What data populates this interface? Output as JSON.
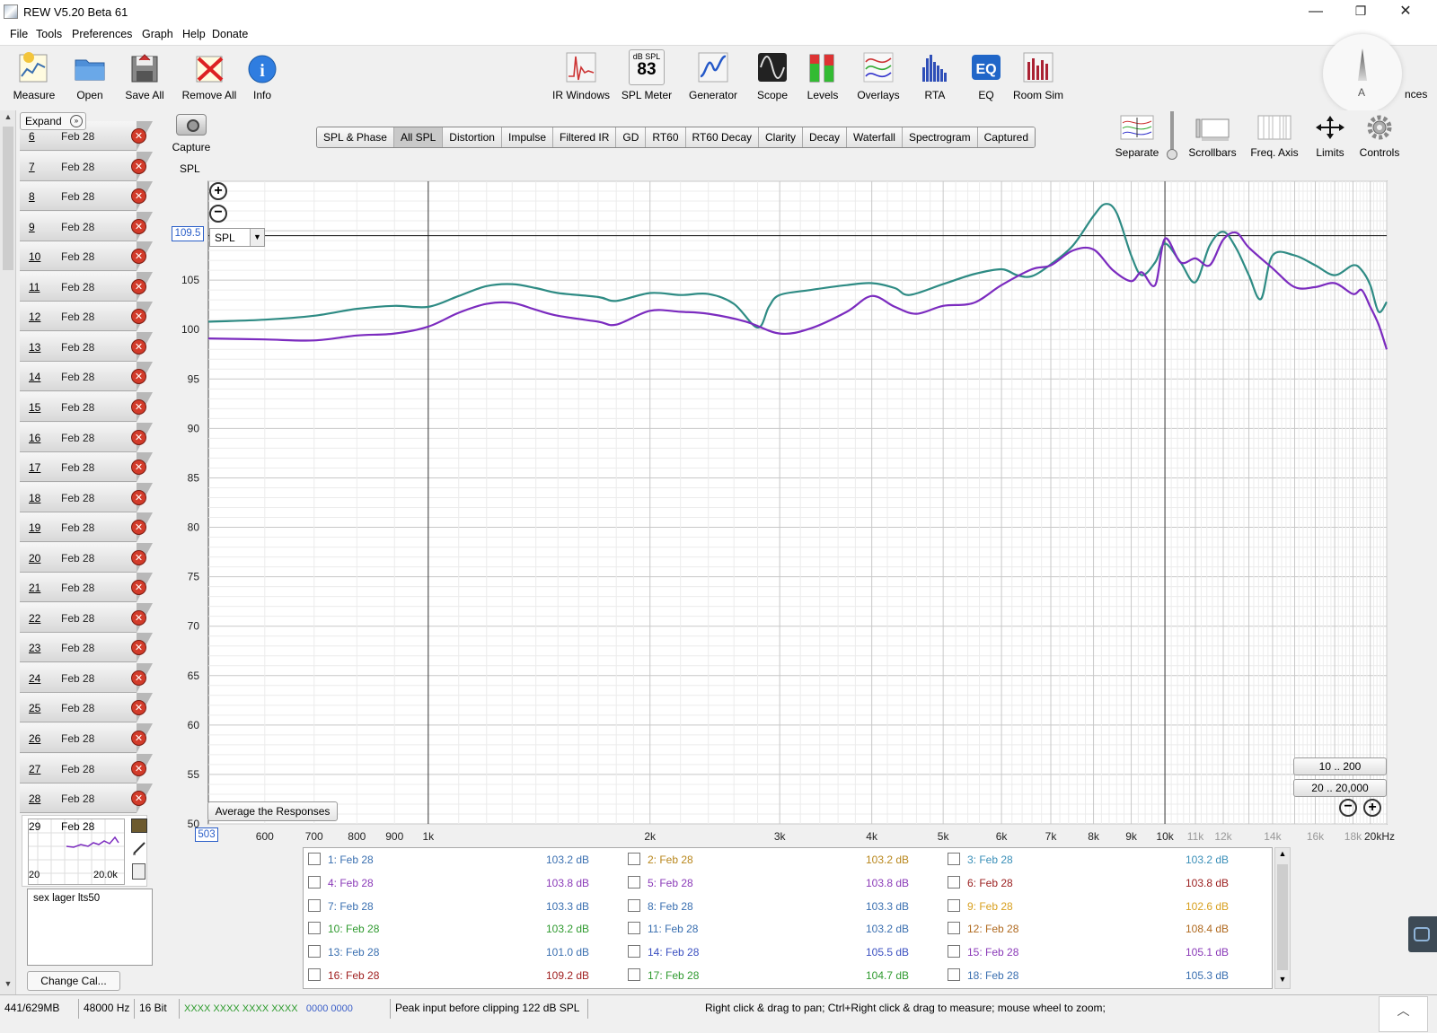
{
  "app": {
    "title": "REW V5.20 Beta 61"
  },
  "window_controls": {
    "minimize": "—",
    "restore": "❐",
    "close": "✕"
  },
  "menu": [
    "File",
    "Tools",
    "Preferences",
    "Graph",
    "Help",
    "Donate"
  ],
  "toolbar": {
    "left": [
      "Measure",
      "Open",
      "Save All",
      "Remove All",
      "Info"
    ],
    "center": [
      "IR Windows",
      "SPL Meter",
      "Generator",
      "Scope",
      "Levels",
      "Overlays",
      "RTA",
      "EQ",
      "Room Sim"
    ],
    "spl_meter_label": "dB SPL",
    "spl_meter_value": "83",
    "prefs_partial": "nces",
    "dial_letter": "A"
  },
  "measurements": {
    "expand_label": "Expand",
    "items": [
      {
        "num": "6",
        "date": "Feb 28"
      },
      {
        "num": "7",
        "date": "Feb 28"
      },
      {
        "num": "8",
        "date": "Feb 28"
      },
      {
        "num": "9",
        "date": "Feb 28"
      },
      {
        "num": "10",
        "date": "Feb 28"
      },
      {
        "num": "11",
        "date": "Feb 28"
      },
      {
        "num": "12",
        "date": "Feb 28"
      },
      {
        "num": "13",
        "date": "Feb 28"
      },
      {
        "num": "14",
        "date": "Feb 28"
      },
      {
        "num": "15",
        "date": "Feb 28"
      },
      {
        "num": "16",
        "date": "Feb 28"
      },
      {
        "num": "17",
        "date": "Feb 28"
      },
      {
        "num": "18",
        "date": "Feb 28"
      },
      {
        "num": "19",
        "date": "Feb 28"
      },
      {
        "num": "20",
        "date": "Feb 28"
      },
      {
        "num": "21",
        "date": "Feb 28"
      },
      {
        "num": "22",
        "date": "Feb 28"
      },
      {
        "num": "23",
        "date": "Feb 28"
      },
      {
        "num": "24",
        "date": "Feb 28"
      },
      {
        "num": "25",
        "date": "Feb 28"
      },
      {
        "num": "26",
        "date": "Feb 28"
      },
      {
        "num": "27",
        "date": "Feb 28"
      },
      {
        "num": "28",
        "date": "Feb 28"
      }
    ],
    "selected": {
      "num": "29",
      "date": "Feb 28",
      "range_low": "20",
      "range_high": "20.0k",
      "notes": "sex lager lts50"
    },
    "change_cal_label": "Change Cal..."
  },
  "graph": {
    "capture_label": "Capture",
    "tabs": [
      "SPL & Phase",
      "All SPL",
      "Distortion",
      "Impulse",
      "Filtered IR",
      "GD",
      "RT60",
      "RT60 Decay",
      "Clarity",
      "Decay",
      "Waterfall",
      "Spectrogram",
      "Captured"
    ],
    "active_tab": "All SPL",
    "right_controls": [
      "Separate",
      "Scrollbars",
      "Freq. Axis",
      "Limits",
      "Controls"
    ],
    "axis_label": "SPL",
    "cursor_value": "109.5",
    "cursor_freq": "503",
    "selector_value": "SPL",
    "average_button": "Average the Responses",
    "range_buttons": [
      "10 .. 200",
      "20 .. 20,000"
    ],
    "zoom_in": "⊕",
    "zoom_out": "⊖"
  },
  "chart_data": {
    "type": "line",
    "ylabel": "SPL",
    "x_scale": "log",
    "xlim": [
      503,
      20000
    ],
    "ylim": [
      50,
      115
    ],
    "y_ticks": [
      50,
      55,
      60,
      65,
      70,
      75,
      80,
      85,
      90,
      95,
      100,
      105
    ],
    "x_tick_labels": [
      {
        "f": 600,
        "label": "600"
      },
      {
        "f": 700,
        "label": "700"
      },
      {
        "f": 800,
        "label": "800"
      },
      {
        "f": 900,
        "label": "900"
      },
      {
        "f": 1000,
        "label": "1k"
      },
      {
        "f": 2000,
        "label": "2k"
      },
      {
        "f": 3000,
        "label": "3k"
      },
      {
        "f": 4000,
        "label": "4k"
      },
      {
        "f": 5000,
        "label": "5k"
      },
      {
        "f": 6000,
        "label": "6k"
      },
      {
        "f": 7000,
        "label": "7k"
      },
      {
        "f": 8000,
        "label": "8k"
      },
      {
        "f": 9000,
        "label": "9k"
      },
      {
        "f": 10000,
        "label": "10k"
      },
      {
        "f": 11000,
        "label": "11k"
      },
      {
        "f": 12000,
        "label": "12k"
      },
      {
        "f": 14000,
        "label": "14k"
      },
      {
        "f": 16000,
        "label": "16k"
      },
      {
        "f": 18000,
        "label": "18k"
      },
      {
        "f": 20000,
        "label": "20kHz"
      }
    ],
    "cursor_y": 109.5,
    "grid": true,
    "series": [
      {
        "color": "#2e8b84",
        "points": [
          [
            503,
            100.8
          ],
          [
            600,
            101.0
          ],
          [
            700,
            101.4
          ],
          [
            800,
            102.1
          ],
          [
            900,
            102.4
          ],
          [
            1000,
            102.3
          ],
          [
            1100,
            103.4
          ],
          [
            1200,
            104.4
          ],
          [
            1300,
            104.6
          ],
          [
            1400,
            104.2
          ],
          [
            1500,
            103.7
          ],
          [
            1700,
            103.3
          ],
          [
            1800,
            102.9
          ],
          [
            2000,
            103.7
          ],
          [
            2200,
            103.5
          ],
          [
            2400,
            103.6
          ],
          [
            2600,
            102.6
          ],
          [
            2800,
            100.2
          ],
          [
            2900,
            102.3
          ],
          [
            3000,
            103.5
          ],
          [
            3300,
            104.0
          ],
          [
            3700,
            104.5
          ],
          [
            4000,
            104.7
          ],
          [
            4300,
            104.2
          ],
          [
            4500,
            103.5
          ],
          [
            5000,
            104.6
          ],
          [
            5500,
            105.6
          ],
          [
            6000,
            106.1
          ],
          [
            6300,
            105.5
          ],
          [
            6600,
            105.4
          ],
          [
            7000,
            106.6
          ],
          [
            7500,
            108.5
          ],
          [
            8000,
            111.5
          ],
          [
            8300,
            112.7
          ],
          [
            8600,
            111.8
          ],
          [
            9000,
            107.5
          ],
          [
            9300,
            105.5
          ],
          [
            9700,
            106.8
          ],
          [
            10000,
            108.7
          ],
          [
            10500,
            106.8
          ],
          [
            11000,
            104.8
          ],
          [
            11500,
            108.5
          ],
          [
            12000,
            109.9
          ],
          [
            12500,
            108.2
          ],
          [
            13000,
            105.5
          ],
          [
            13500,
            103.1
          ],
          [
            14000,
            107.5
          ],
          [
            15000,
            107.5
          ],
          [
            16000,
            106.5
          ],
          [
            17000,
            105.5
          ],
          [
            18000,
            106.5
          ],
          [
            18500,
            106.0
          ],
          [
            19000,
            104.5
          ],
          [
            19500,
            101.8
          ],
          [
            20000,
            102.8
          ]
        ]
      },
      {
        "color": "#7b2bbf",
        "points": [
          [
            503,
            99.1
          ],
          [
            600,
            99.0
          ],
          [
            700,
            98.9
          ],
          [
            800,
            99.4
          ],
          [
            900,
            99.6
          ],
          [
            1000,
            100.3
          ],
          [
            1100,
            101.7
          ],
          [
            1200,
            102.6
          ],
          [
            1300,
            102.7
          ],
          [
            1400,
            102.0
          ],
          [
            1500,
            101.4
          ],
          [
            1700,
            100.8
          ],
          [
            1800,
            100.5
          ],
          [
            2000,
            101.9
          ],
          [
            2200,
            101.8
          ],
          [
            2400,
            101.6
          ],
          [
            2700,
            100.8
          ],
          [
            3000,
            99.6
          ],
          [
            3300,
            100.1
          ],
          [
            3700,
            101.8
          ],
          [
            4000,
            103.4
          ],
          [
            4300,
            102.3
          ],
          [
            4600,
            101.6
          ],
          [
            5000,
            102.4
          ],
          [
            5500,
            102.7
          ],
          [
            6000,
            104.5
          ],
          [
            6600,
            106.1
          ],
          [
            7000,
            106.5
          ],
          [
            7500,
            108.0
          ],
          [
            8000,
            108.1
          ],
          [
            8500,
            106.0
          ],
          [
            9000,
            104.9
          ],
          [
            9300,
            105.8
          ],
          [
            9700,
            104.5
          ],
          [
            10000,
            109.2
          ],
          [
            10500,
            106.8
          ],
          [
            11000,
            107.2
          ],
          [
            11500,
            106.5
          ],
          [
            12000,
            109.1
          ],
          [
            12500,
            109.8
          ],
          [
            13000,
            108.3
          ],
          [
            14000,
            106.2
          ],
          [
            15000,
            104.3
          ],
          [
            16000,
            104.3
          ],
          [
            17000,
            104.7
          ],
          [
            18000,
            103.6
          ],
          [
            18500,
            104.0
          ],
          [
            19000,
            102.3
          ],
          [
            19500,
            100.5
          ],
          [
            20000,
            98.0
          ]
        ]
      }
    ]
  },
  "legend": {
    "rows": [
      [
        {
          "name": "1: Feb 28",
          "value": "103.2 dB",
          "color": "#3a6fb0"
        },
        {
          "name": "2: Feb 28",
          "value": "103.2 dB",
          "color": "#b8861b"
        },
        {
          "name": "3: Feb 28",
          "value": "103.2 dB",
          "color": "#3a8fb8"
        }
      ],
      [
        {
          "name": "4: Feb 28",
          "value": "103.8 dB",
          "color": "#8a3ab8"
        },
        {
          "name": "5: Feb 28",
          "value": "103.8 dB",
          "color": "#8a3ab8"
        },
        {
          "name": "6: Feb 28",
          "value": "103.8 dB",
          "color": "#9b2020"
        }
      ],
      [
        {
          "name": "7: Feb 28",
          "value": "103.3 dB",
          "color": "#3a6fb0"
        },
        {
          "name": "8: Feb 28",
          "value": "103.3 dB",
          "color": "#3a6fb0"
        },
        {
          "name": "9: Feb 28",
          "value": "102.6 dB",
          "color": "#d8a020"
        }
      ],
      [
        {
          "name": "10: Feb 28",
          "value": "103.2 dB",
          "color": "#2f9a2f"
        },
        {
          "name": "11: Feb 28",
          "value": "103.2 dB",
          "color": "#3a6fb0"
        },
        {
          "name": "12: Feb 28",
          "value": "108.4 dB",
          "color": "#b06a20"
        }
      ],
      [
        {
          "name": "13: Feb 28",
          "value": "101.0 dB",
          "color": "#3a6fb0"
        },
        {
          "name": "14: Feb 28",
          "value": "105.5 dB",
          "color": "#3a4fc0"
        },
        {
          "name": "15: Feb 28",
          "value": "105.1 dB",
          "color": "#8a3ab8"
        }
      ],
      [
        {
          "name": "16: Feb 28",
          "value": "109.2 dB",
          "color": "#a02020"
        },
        {
          "name": "17: Feb 28",
          "value": "104.7 dB",
          "color": "#2f9a2f"
        },
        {
          "name": "18: Feb 28",
          "value": "105.3 dB",
          "color": "#3a6fb0"
        }
      ]
    ]
  },
  "status": {
    "memory": "441/629MB",
    "rate": "48000 Hz",
    "bits": "16 Bit",
    "input_green": "XXXX XXXX  XXXX XXXX",
    "input_blue": "0000 0000",
    "peak": "Peak input before clipping 122 dB SPL",
    "hint": "Right click & drag to pan; Ctrl+Right click & drag to measure; mouse wheel to zoom;"
  }
}
